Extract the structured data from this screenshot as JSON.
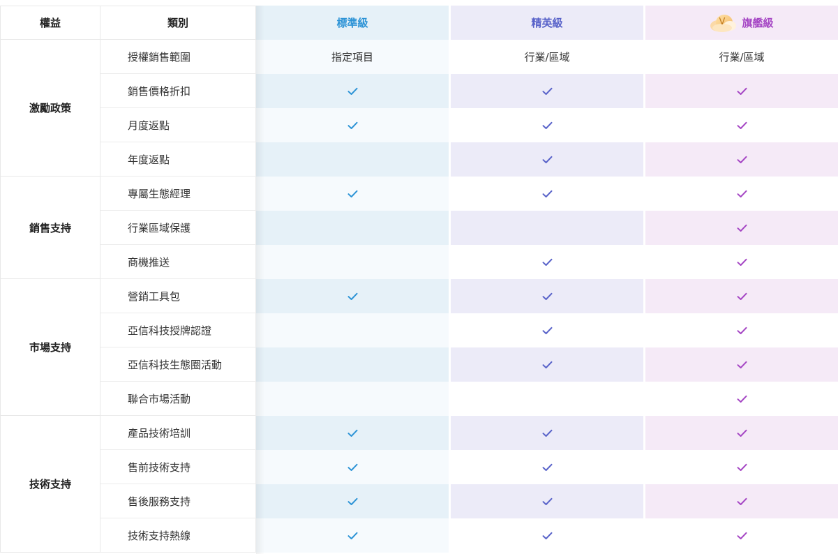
{
  "header": {
    "benefit_label": "權益",
    "category_label": "類別",
    "tiers": [
      {
        "name": "標準級",
        "color": "#2c93d6"
      },
      {
        "name": "精英級",
        "color": "#5862c9"
      },
      {
        "name": "旗艦級",
        "color": "#a546c4",
        "badge_icon": "crown-v-icon",
        "badge_letter": "V"
      }
    ]
  },
  "groups": [
    {
      "name": "激勵政策",
      "items": [
        {
          "label": "授權銷售範圍",
          "values": [
            "指定項目",
            "行業/區域",
            "行業/區域"
          ]
        },
        {
          "label": "銷售價格折扣",
          "values": [
            true,
            true,
            true
          ]
        },
        {
          "label": "月度返點",
          "values": [
            true,
            true,
            true
          ]
        },
        {
          "label": "年度返點",
          "values": [
            false,
            true,
            true
          ]
        }
      ]
    },
    {
      "name": "銷售支持",
      "items": [
        {
          "label": "專屬生態經理",
          "values": [
            true,
            true,
            true
          ]
        },
        {
          "label": "行業區域保護",
          "values": [
            false,
            false,
            true
          ]
        },
        {
          "label": "商機推送",
          "values": [
            false,
            true,
            true
          ]
        }
      ]
    },
    {
      "name": "市場支持",
      "items": [
        {
          "label": "營銷工具包",
          "values": [
            true,
            true,
            true
          ]
        },
        {
          "label": "亞信科技授牌認證",
          "values": [
            false,
            true,
            true
          ]
        },
        {
          "label": "亞信科技生態圈活動",
          "values": [
            false,
            true,
            true
          ]
        },
        {
          "label": "聯合市場活動",
          "values": [
            false,
            false,
            true
          ]
        }
      ]
    },
    {
      "name": "技術支持",
      "items": [
        {
          "label": "產品技術培訓",
          "values": [
            true,
            true,
            true
          ]
        },
        {
          "label": "售前技術支持",
          "values": [
            true,
            true,
            true
          ]
        },
        {
          "label": "售後服務支持",
          "values": [
            true,
            true,
            true
          ]
        },
        {
          "label": "技術支持熱線",
          "values": [
            true,
            true,
            true
          ]
        }
      ]
    }
  ]
}
